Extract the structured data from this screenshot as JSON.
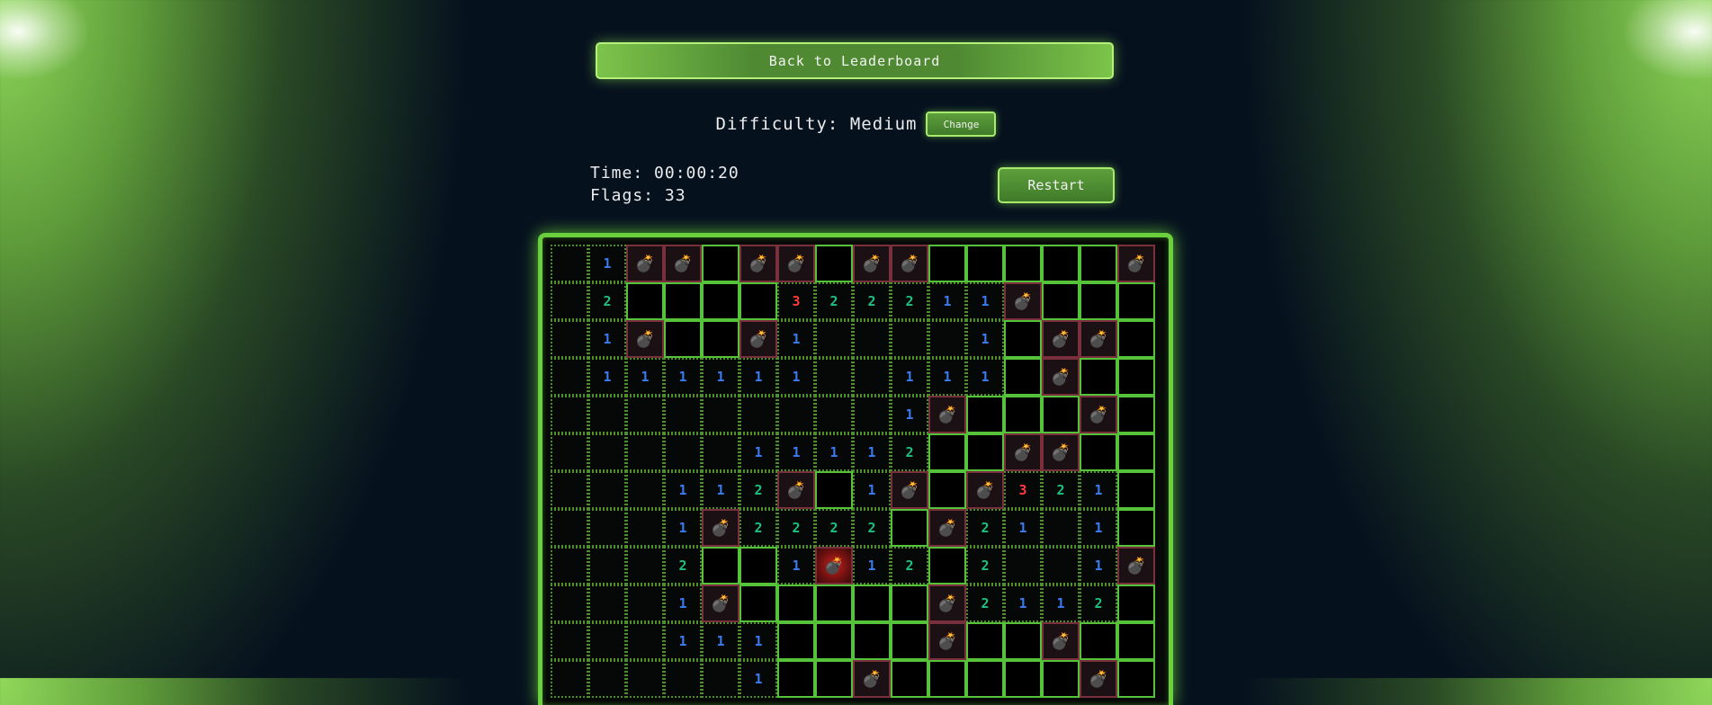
{
  "back_button": "Back to Leaderboard",
  "difficulty": {
    "text": "Difficulty: Medium",
    "change_label": "Change"
  },
  "stats": {
    "time": "Time: 00:00:20",
    "flags": "Flags: 33"
  },
  "restart_label": "Restart",
  "colors": {
    "accent": "#6ad03c",
    "num1": "#3a7cf0",
    "num2": "#1fbf82",
    "num3": "#ff3a3a"
  },
  "board": {
    "columns": 16,
    "legend": {
      "R": "revealed-empty",
      "H": "hidden",
      "M": "mine",
      "X": "exploded-mine",
      "1-8": "number"
    },
    "rows": [
      [
        "R",
        "1",
        "M",
        "M",
        "H",
        "M",
        "M",
        "H",
        "M",
        "M",
        "H",
        "H",
        "H",
        "H",
        "H",
        "M"
      ],
      [
        "R",
        "2",
        "H",
        "H",
        "H",
        "H",
        "3",
        "2",
        "2",
        "2",
        "1",
        "1",
        "M",
        "H",
        "H",
        "H"
      ],
      [
        "R",
        "1",
        "M",
        "H",
        "H",
        "M",
        "1",
        "R",
        "R",
        "R",
        "R",
        "1",
        "H",
        "M",
        "M",
        "H"
      ],
      [
        "R",
        "1",
        "1",
        "1",
        "1",
        "1",
        "1",
        "R",
        "R",
        "1",
        "1",
        "1",
        "H",
        "M",
        "H",
        "H"
      ],
      [
        "R",
        "R",
        "R",
        "R",
        "R",
        "R",
        "R",
        "R",
        "R",
        "1",
        "M",
        "H",
        "H",
        "H",
        "M",
        "H"
      ],
      [
        "R",
        "R",
        "R",
        "R",
        "R",
        "1",
        "1",
        "1",
        "1",
        "2",
        "H",
        "H",
        "M",
        "M",
        "H",
        "H"
      ],
      [
        "R",
        "R",
        "R",
        "1",
        "1",
        "2",
        "M",
        "H",
        "1",
        "M",
        "H",
        "M",
        "3",
        "2",
        "1",
        "H"
      ],
      [
        "R",
        "R",
        "R",
        "1",
        "M",
        "2",
        "2",
        "2",
        "2",
        "H",
        "M",
        "2",
        "1",
        "R",
        "1",
        "H"
      ],
      [
        "R",
        "R",
        "R",
        "2",
        "H",
        "H",
        "1",
        "X",
        "1",
        "2",
        "H",
        "2",
        "R",
        "R",
        "1",
        "M"
      ],
      [
        "R",
        "R",
        "R",
        "1",
        "M",
        "H",
        "H",
        "H",
        "H",
        "H",
        "M",
        "2",
        "1",
        "1",
        "2",
        "H"
      ],
      [
        "R",
        "R",
        "R",
        "1",
        "1",
        "1",
        "H",
        "H",
        "H",
        "H",
        "M",
        "H",
        "H",
        "M",
        "H",
        "H"
      ],
      [
        "R",
        "R",
        "R",
        "R",
        "R",
        "1",
        "H",
        "H",
        "M",
        "H",
        "H",
        "H",
        "H",
        "H",
        "M",
        "H"
      ]
    ]
  }
}
